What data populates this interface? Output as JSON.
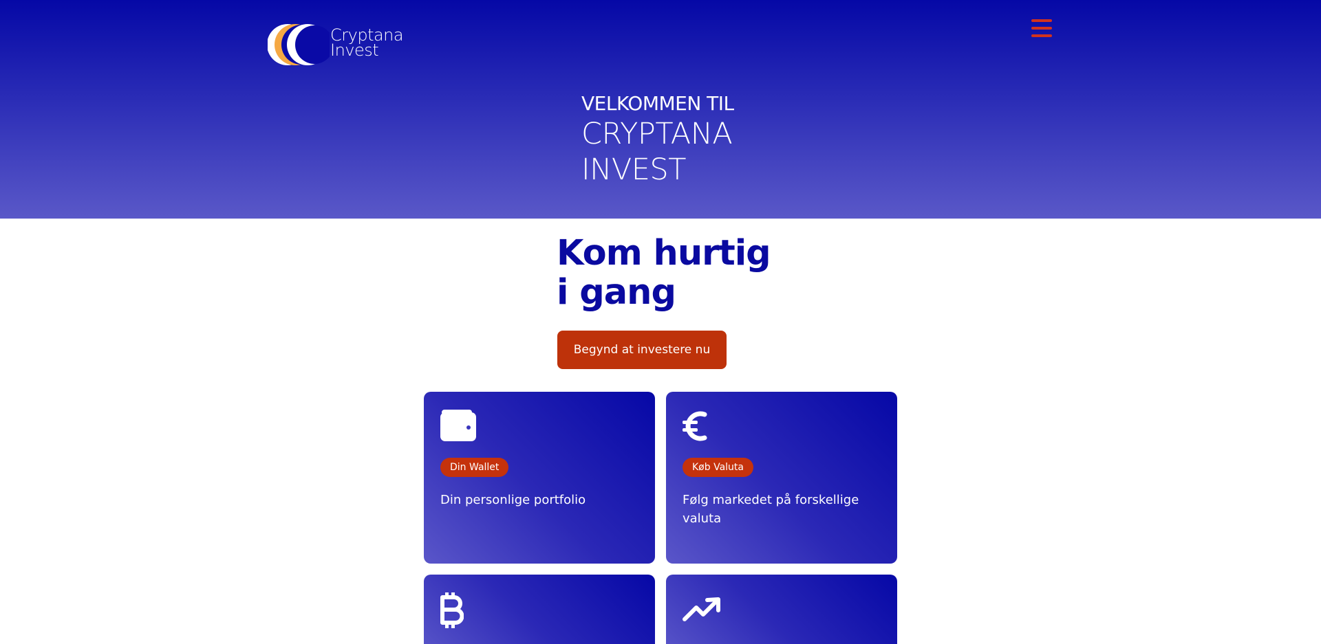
{
  "header": {
    "logo_text_line1": "Cryptana",
    "logo_text_line2": "Invest",
    "menu_icon": "hamburger-menu-icon"
  },
  "hero": {
    "welcome": "VELKOMMEN TIL",
    "brand_line1": "CRYPTANA",
    "brand_line2": "INVEST"
  },
  "main": {
    "heading_line1": "Kom hurtig",
    "heading_line2": "i gang",
    "cta_label": "Begynd at investere nu"
  },
  "cards": [
    {
      "icon": "wallet-icon",
      "badge": "Din Wallet",
      "text": "Din personlige portfolio"
    },
    {
      "icon": "euro-icon",
      "badge": "Køb Valuta",
      "text": "Følg markedet på forskellige valuta"
    },
    {
      "icon": "bitcoin-icon",
      "badge": "",
      "text": ""
    },
    {
      "icon": "trending-up-icon",
      "badge": "",
      "text": ""
    }
  ],
  "colors": {
    "hero_top": "#0508a6",
    "hero_bottom": "#5a58c8",
    "accent": "#be320a",
    "heading": "#0a0aa0",
    "menu_icon": "#d2331e"
  }
}
